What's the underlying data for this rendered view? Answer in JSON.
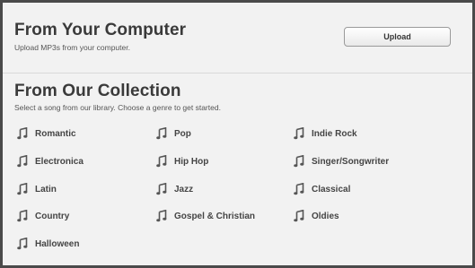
{
  "computer_section": {
    "title": "From Your Computer",
    "subtitle": "Upload MP3s from your computer.",
    "upload_label": "Upload"
  },
  "collection_section": {
    "title": "From Our Collection",
    "subtitle": "Select a song from our library. Choose a genre to get started.",
    "genre_icon": "music-note-icon",
    "genres": [
      "Romantic",
      "Pop",
      "Indie Rock",
      "Electronica",
      "Hip Hop",
      "Singer/Songwriter",
      "Latin",
      "Jazz",
      "Classical",
      "Country",
      "Gospel & Christian",
      "Oldies",
      "Halloween"
    ]
  },
  "colors": {
    "panel_bg": "#f2f2f2",
    "border": "#4a4a4a",
    "text": "#3d3d3d"
  }
}
